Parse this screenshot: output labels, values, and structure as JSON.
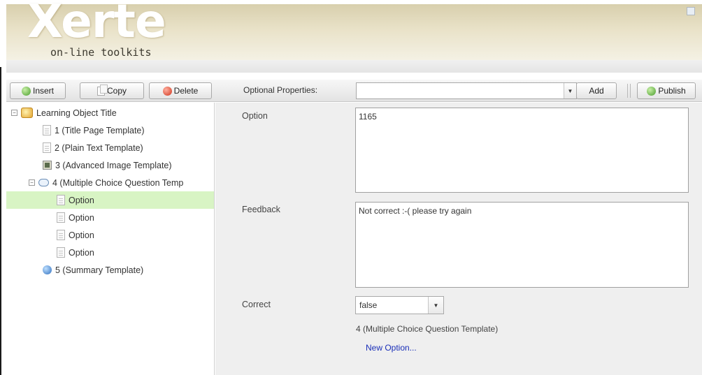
{
  "header": {
    "logo_word": "Xerte",
    "logo_subtitle": "on-line toolkits"
  },
  "toolbar": {
    "insert_label": "Insert",
    "copy_label": "Copy",
    "delete_label": "Delete",
    "optional_properties_label": "Optional Properties:",
    "optional_properties_value": "",
    "add_label": "Add",
    "publish_label": "Publish"
  },
  "tree": {
    "root": {
      "label": "Learning Object Title",
      "icon": "folder-icon",
      "expanded": true
    },
    "items": [
      {
        "label": "1 (Title Page Template)",
        "icon": "page-icon"
      },
      {
        "label": "2 (Plain Text Template)",
        "icon": "page-icon"
      },
      {
        "label": "3 (Advanced Image Template)",
        "icon": "image-icon"
      },
      {
        "label": "4 (Multiple Choice Question Temp",
        "icon": "speech-bubble-icon",
        "expanded": true
      },
      {
        "label": "Option",
        "icon": "page-icon",
        "selected": true
      },
      {
        "label": "Option",
        "icon": "page-icon"
      },
      {
        "label": "Option",
        "icon": "page-icon"
      },
      {
        "label": "Option",
        "icon": "page-icon"
      },
      {
        "label": "5 (Summary Template)",
        "icon": "summary-icon"
      }
    ]
  },
  "properties": {
    "option_label": "Option",
    "option_value": "1165",
    "feedback_label": "Feedback",
    "feedback_value": "Not correct :-( please try again",
    "correct_label": "Correct",
    "correct_value": "false",
    "path_text": "4 (Multiple Choice Question Template)",
    "new_option_label": "New Option..."
  },
  "colors": {
    "header_gradient_top": "#d8cfad",
    "selected_row": "#d8f4c4",
    "props_background": "#efefef",
    "link": "#1a2fb8"
  }
}
